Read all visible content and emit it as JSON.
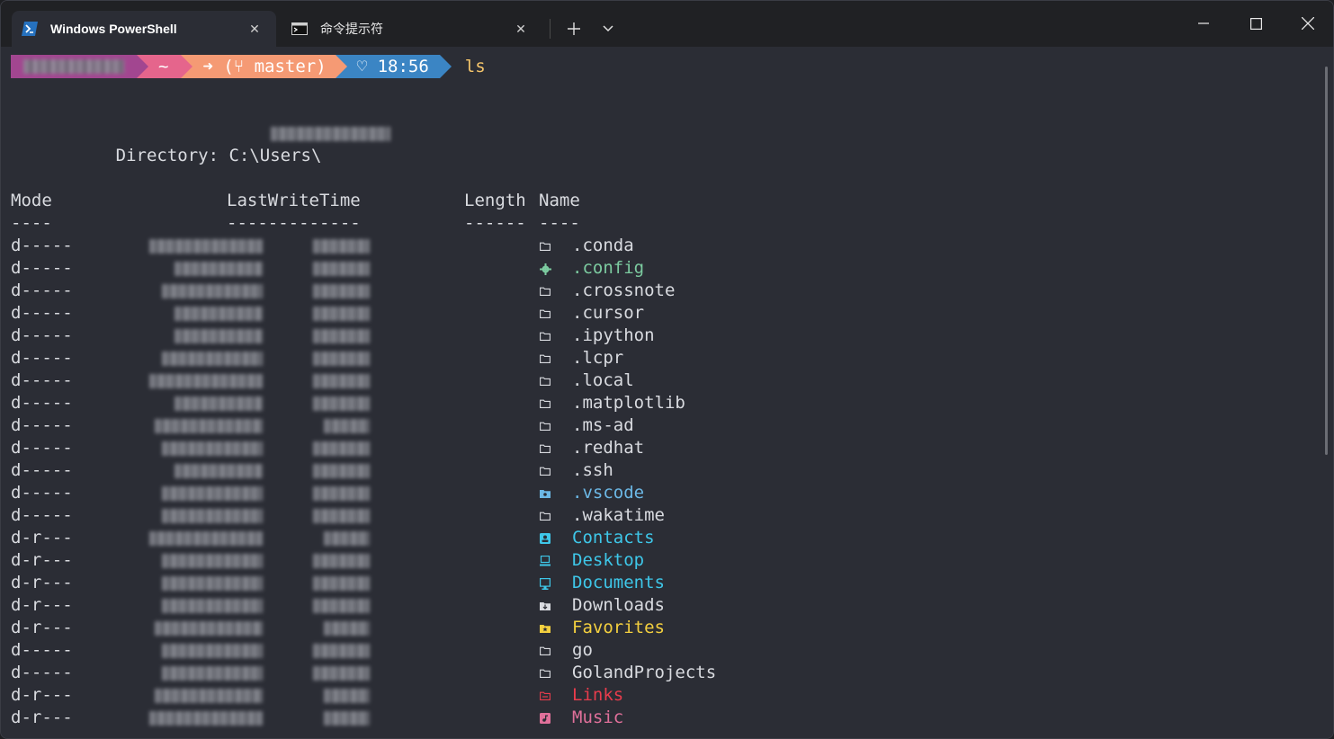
{
  "tabs": [
    {
      "title": "Windows PowerShell",
      "icon": "powershell-icon",
      "active": true
    },
    {
      "title": "命令提示符",
      "icon": "cmd-icon",
      "active": false
    }
  ],
  "window_controls": {
    "minimize": "—",
    "maximize": "☐",
    "close": "✕"
  },
  "prompt": {
    "path": "~",
    "git": "➜ (⑂ master)",
    "time": "♡ 18:56",
    "command": "ls"
  },
  "directory_label": "Directory: C:\\Users\\",
  "headers": {
    "mode": "Mode",
    "mode_rule": "----",
    "lastwrite": "LastWriteTime",
    "lastwrite_rule": "-------------",
    "length": "Length",
    "length_rule": "------",
    "name": "Name",
    "name_rule": "----"
  },
  "colors": {
    "default": "#d9dbe0",
    "config": "#7ccba0",
    "vscode": "#6cb8e6",
    "special": "#3ec7e9",
    "downloads": "#d9dbe0",
    "favorites": "#f4d03f",
    "links": "#e83c4c",
    "music": "#e0709a"
  },
  "entries": [
    {
      "mode": "d-----",
      "name": ".conda",
      "icon": "folder-icon",
      "color": "default"
    },
    {
      "mode": "d-----",
      "name": ".config",
      "icon": "gear-icon",
      "color": "config"
    },
    {
      "mode": "d-----",
      "name": ".crossnote",
      "icon": "folder-icon",
      "color": "default"
    },
    {
      "mode": "d-----",
      "name": ".cursor",
      "icon": "folder-icon",
      "color": "default"
    },
    {
      "mode": "d-----",
      "name": ".ipython",
      "icon": "folder-icon",
      "color": "default"
    },
    {
      "mode": "d-----",
      "name": ".lcpr",
      "icon": "folder-icon",
      "color": "default"
    },
    {
      "mode": "d-----",
      "name": ".local",
      "icon": "folder-icon",
      "color": "default"
    },
    {
      "mode": "d-----",
      "name": ".matplotlib",
      "icon": "folder-icon",
      "color": "default"
    },
    {
      "mode": "d-----",
      "name": ".ms-ad",
      "icon": "folder-icon",
      "color": "default"
    },
    {
      "mode": "d-----",
      "name": ".redhat",
      "icon": "folder-icon",
      "color": "default"
    },
    {
      "mode": "d-----",
      "name": ".ssh",
      "icon": "folder-icon",
      "color": "default"
    },
    {
      "mode": "d-----",
      "name": ".vscode",
      "icon": "vscode-folder-icon",
      "color": "vscode"
    },
    {
      "mode": "d-----",
      "name": ".wakatime",
      "icon": "folder-icon",
      "color": "default"
    },
    {
      "mode": "d-r---",
      "name": "Contacts",
      "icon": "contacts-icon",
      "color": "special"
    },
    {
      "mode": "d-r---",
      "name": "Desktop",
      "icon": "desktop-icon",
      "color": "special"
    },
    {
      "mode": "d-r---",
      "name": "Documents",
      "icon": "documents-icon",
      "color": "special"
    },
    {
      "mode": "d-r---",
      "name": "Downloads",
      "icon": "downloads-icon",
      "color": "downloads"
    },
    {
      "mode": "d-r---",
      "name": "Favorites",
      "icon": "favorites-icon",
      "color": "favorites"
    },
    {
      "mode": "d-----",
      "name": "go",
      "icon": "folder-icon",
      "color": "default"
    },
    {
      "mode": "d-----",
      "name": "GolandProjects",
      "icon": "folder-icon",
      "color": "default"
    },
    {
      "mode": "d-r---",
      "name": "Links",
      "icon": "links-icon",
      "color": "links"
    },
    {
      "mode": "d-r---",
      "name": "Music",
      "icon": "music-icon",
      "color": "music"
    }
  ]
}
